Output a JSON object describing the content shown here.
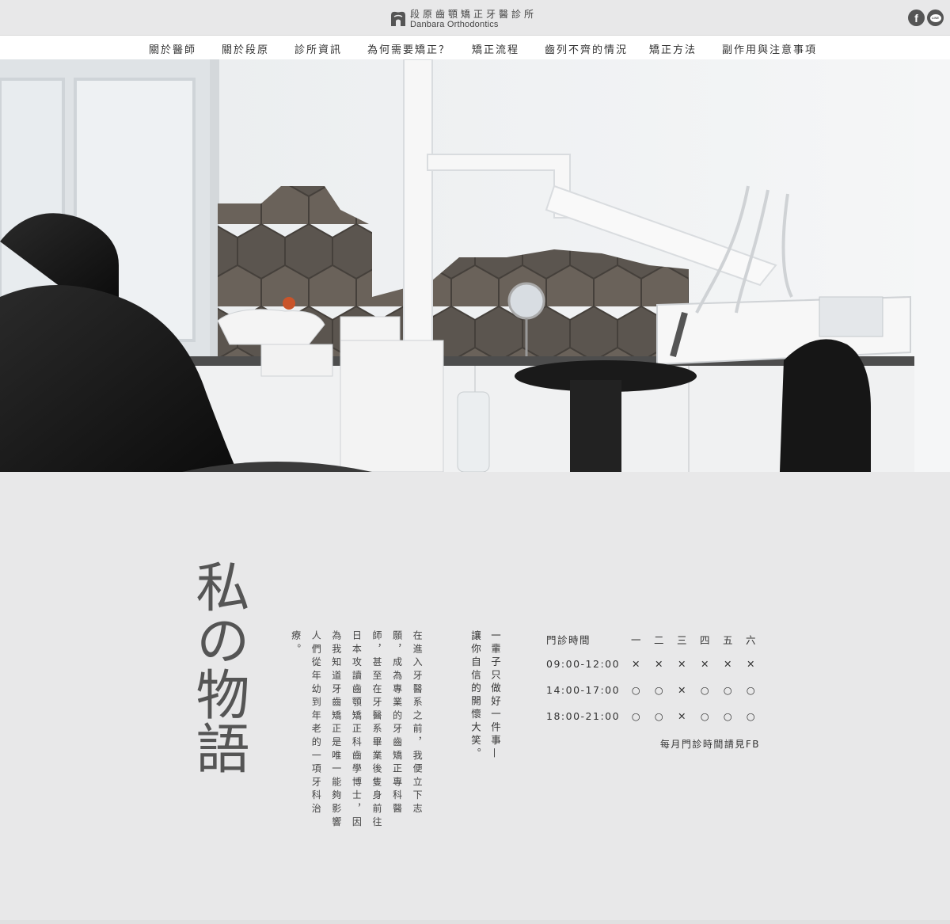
{
  "header": {
    "logo_cn": "段原齒顎矯正牙醫診所",
    "logo_en": "Danbara Orthodontics",
    "social": [
      {
        "name": "facebook",
        "glyph": "f"
      },
      {
        "name": "line",
        "glyph": "LINE"
      }
    ]
  },
  "nav": {
    "items": [
      "關於醫師",
      "關於段原",
      "診所資訊",
      "為何需要矯正？",
      "矯正流程",
      "齒列不齊的情況",
      "矯正方法",
      "副作用與注意事項"
    ]
  },
  "hero": {
    "icon": "dental-chair-photo"
  },
  "story": {
    "title": "私の物語",
    "body": "在進入牙醫系之前，我便立下志願，成為專業的牙齒矯正專科醫師，甚至在牙醫系畢業後隻身前往日本攻讀齒顎矯正科齒學博士，因為我知道牙齒矯正是唯一能夠影響人們從年幼到年老的一項牙科治療。",
    "slogan": "一輩子只做好一件事— 讓你自信的開懷大笑。"
  },
  "schedule": {
    "header_label": "門診時間",
    "days": [
      "一",
      "二",
      "三",
      "四",
      "五",
      "六"
    ],
    "rows": [
      {
        "time": "09:00-12:00",
        "slots": [
          "✕",
          "✕",
          "✕",
          "✕",
          "✕",
          "✕"
        ]
      },
      {
        "time": "14:00-17:00",
        "slots": [
          "○",
          "○",
          "✕",
          "○",
          "○",
          "○"
        ]
      },
      {
        "time": "18:00-21:00",
        "slots": [
          "○",
          "○",
          "✕",
          "○",
          "○",
          "○"
        ]
      }
    ],
    "note": "每月門診時間請見FB"
  },
  "colors": {
    "background": "#e8e8e9",
    "nav_background": "#ffffff",
    "text": "#333333"
  }
}
